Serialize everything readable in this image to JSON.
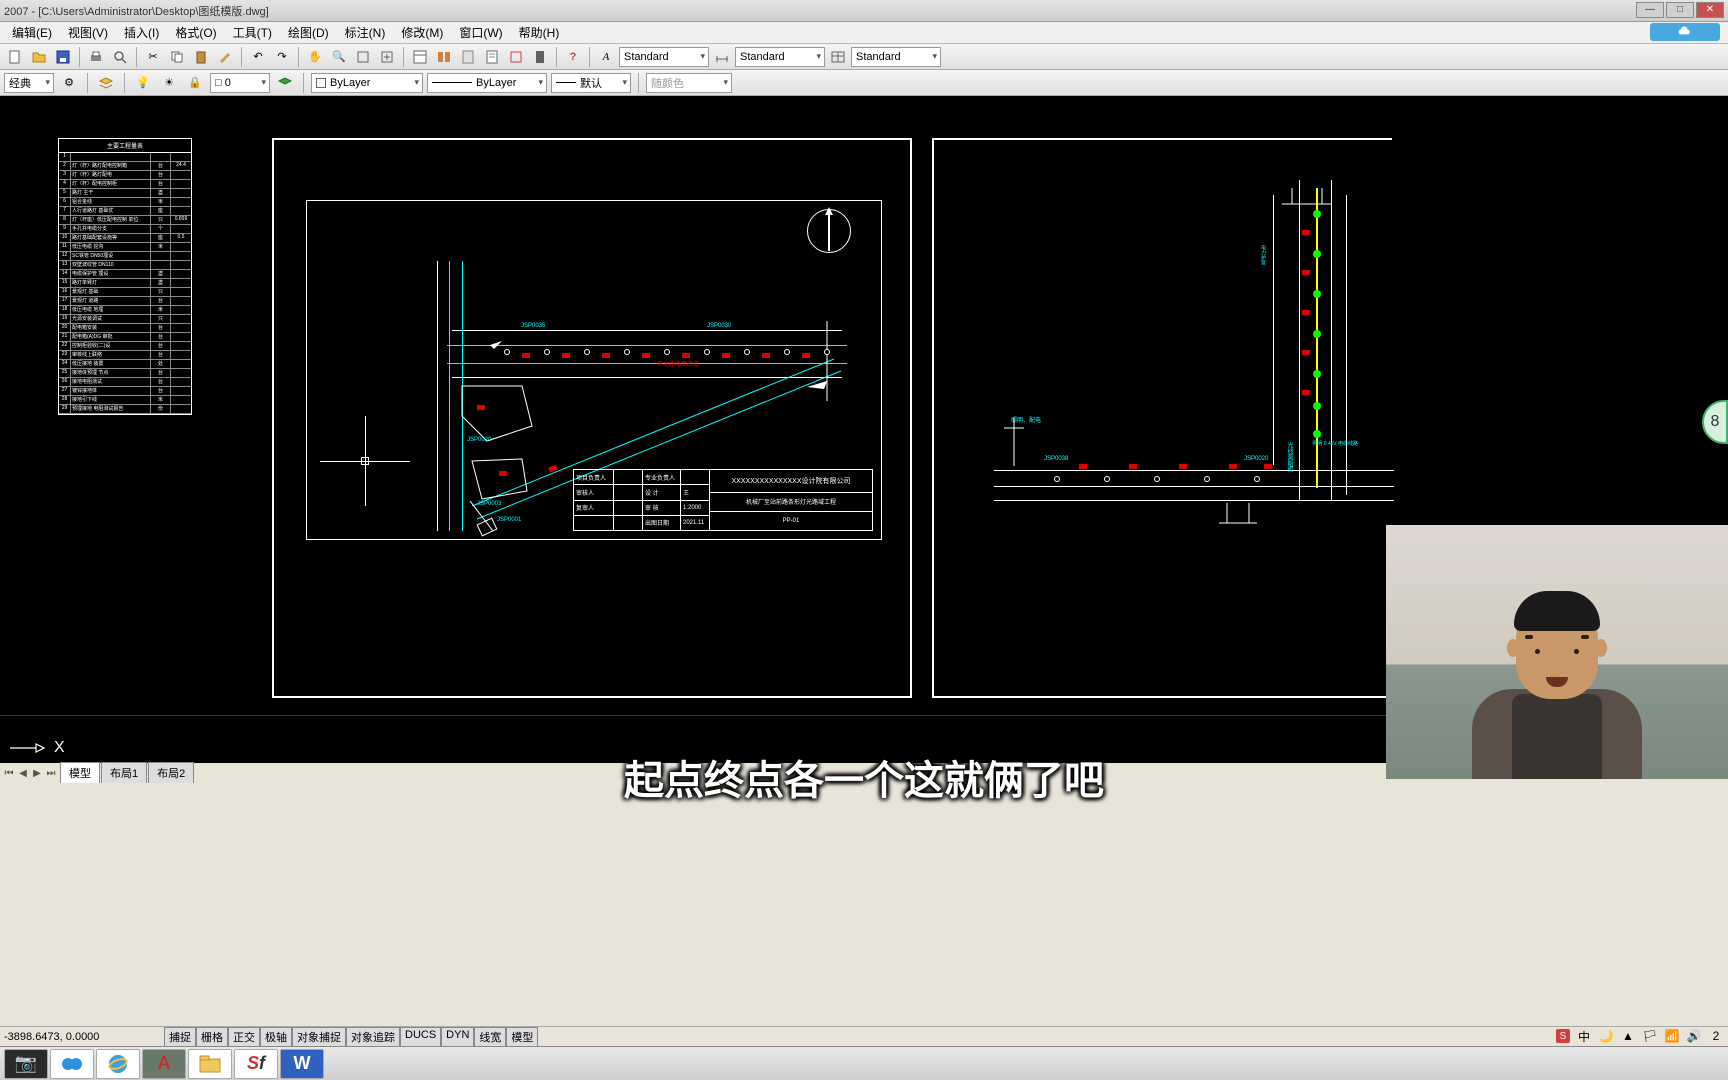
{
  "window": {
    "title": "2007 - [C:\\Users\\Administrator\\Desktop\\图纸模版.dwg]"
  },
  "menu": {
    "items": [
      "编辑(E)",
      "视图(V)",
      "插入(I)",
      "格式(O)",
      "工具(T)",
      "绘图(D)",
      "标注(N)",
      "修改(M)",
      "窗口(W)",
      "帮助(H)"
    ]
  },
  "toolbar": {
    "style1": "Standard",
    "style2": "Standard",
    "style3": "Standard",
    "workspace": "经典",
    "layer_combo": "□ 0",
    "color": "ByLayer",
    "linetype": "ByLayer",
    "lineweight": "默认",
    "plotstyle": "随颜色"
  },
  "sheet_table": {
    "title": "主要工程量表",
    "rows": [
      {
        "n": "1",
        "name": "",
        "u": "",
        "q": ""
      },
      {
        "n": "2",
        "name": "灯（杆）路灯配电控制箱",
        "u": "台",
        "q": "24.4"
      },
      {
        "n": "3",
        "name": "灯（杆）路灯配电",
        "u": "台",
        "q": ""
      },
      {
        "n": "4",
        "name": "灯（杆）配电控制柜",
        "u": "台",
        "q": ""
      },
      {
        "n": "5",
        "name": "路灯 主干",
        "u": "盏",
        "q": ""
      },
      {
        "n": "6",
        "name": "铝合金线",
        "u": "米",
        "q": ""
      },
      {
        "n": "7",
        "name": "人行道路灯 基础优",
        "u": "座",
        "q": ""
      },
      {
        "n": "8",
        "name": "灯（杆座）低压配电控制 单位",
        "u": "只",
        "q": "0.899"
      },
      {
        "n": "9",
        "name": "手孔井电缆分支",
        "u": "个",
        "q": ""
      },
      {
        "n": "10",
        "name": "路灯基础配套设施等",
        "u": "座",
        "q": "0.5"
      },
      {
        "n": "11",
        "name": "低压电缆 挖沟",
        "u": "米",
        "q": ""
      },
      {
        "n": "12",
        "name": "SC铁管 DN50埋设",
        "u": "",
        "q": ""
      },
      {
        "n": "13",
        "name": "双壁波纹管 DN110",
        "u": "",
        "q": ""
      },
      {
        "n": "14",
        "name": "电缆保护管 埋设",
        "u": "盏",
        "q": ""
      },
      {
        "n": "15",
        "name": "路灯单臂灯",
        "u": "盏",
        "q": ""
      },
      {
        "n": "16",
        "name": "景观灯 基础",
        "u": "只",
        "q": ""
      },
      {
        "n": "17",
        "name": "景观灯 道路",
        "u": "台",
        "q": ""
      },
      {
        "n": "18",
        "name": "低压电缆 地埋",
        "u": "米",
        "q": ""
      },
      {
        "n": "19",
        "name": "光源安装调试",
        "u": "只",
        "q": ""
      },
      {
        "n": "20",
        "name": "配电箱安装",
        "u": "台",
        "q": ""
      },
      {
        "n": "21",
        "name": "配电箱(A)DG 审批",
        "u": "台",
        "q": ""
      },
      {
        "n": "22",
        "name": "控制柜验收(二)设",
        "u": "台",
        "q": ""
      },
      {
        "n": "23",
        "name": "审核线上联络",
        "u": "台",
        "q": ""
      },
      {
        "n": "24",
        "name": "低压接地 装置",
        "u": "处",
        "q": ""
      },
      {
        "n": "25",
        "name": "接地体预埋 节点",
        "u": "台",
        "q": ""
      },
      {
        "n": "26",
        "name": "接地电阻测试",
        "u": "台",
        "q": ""
      },
      {
        "n": "27",
        "name": "镀锌接地体",
        "u": "台",
        "q": ""
      },
      {
        "n": "28",
        "name": "接地引下线",
        "u": "米",
        "q": ""
      },
      {
        "n": "29",
        "name": "预埋接地 电阻测试报告",
        "u": "份",
        "q": ""
      }
    ]
  },
  "drawing1": {
    "road_label": "环北路路面改造",
    "station1": "JSP0035",
    "station2": "JSP0030",
    "station3": "JSP0020",
    "station4": "JSP0003",
    "station5": "JSP0001",
    "title_block": {
      "col1": [
        "项目负责人",
        "审核人",
        "复审人"
      ],
      "col2_labels": [
        "专业负责人",
        "设 计",
        "审 核",
        "出图日期"
      ],
      "col2_vals": [
        "",
        "王",
        "1:2000",
        "2021.11"
      ],
      "company": "XXXXXXXXXXXXXXX设计院有限公司",
      "proj": "机械厂至站前路条形灯光路域工程",
      "sheet": "PP-01"
    }
  },
  "drawing2": {
    "label1": "照明、配电",
    "label2": "JSP0038",
    "label3": "JSP0020",
    "label4": "光线莫斯照",
    "label5": "照明 0.4kV 电缆线路"
  },
  "timer": {
    "value": "8"
  },
  "command": {
    "prompt": "X"
  },
  "tabs": {
    "items": [
      "模型",
      "布局1",
      "布局2"
    ],
    "active": 0
  },
  "subtitle": "起点终点各一个这就俩了吧",
  "status": {
    "coords": "-3898.6473, 0.0000",
    "toggles": [
      "捕捉",
      "栅格",
      "正交",
      "极轴",
      "对象捕捉",
      "对象追踪",
      "DUCS",
      "DYN",
      "线宽",
      "模型"
    ]
  },
  "tray": {
    "ime": "中",
    "time": "2"
  }
}
